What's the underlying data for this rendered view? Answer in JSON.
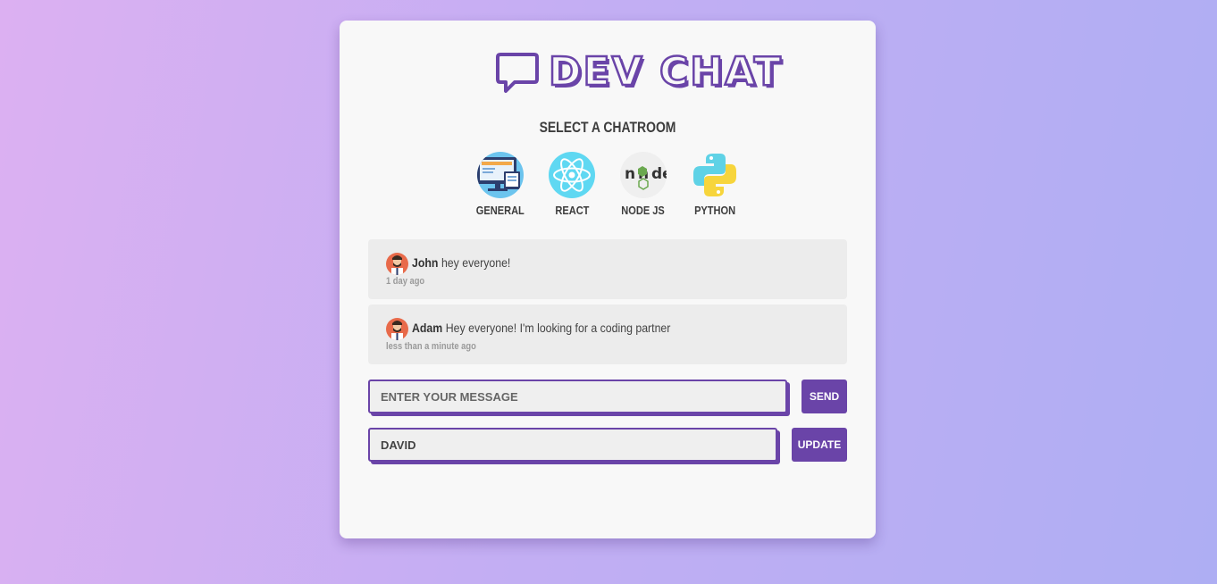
{
  "app": {
    "logo_text": "DEV CHAT"
  },
  "rooms_section": {
    "title": "SELECT A CHATROOM",
    "rooms": [
      {
        "label": "GENERAL",
        "icon": "computer-monitor-icon"
      },
      {
        "label": "REACT",
        "icon": "react-atom-icon"
      },
      {
        "label": "NODE JS",
        "icon": "nodejs-logo-icon"
      },
      {
        "label": "PYTHON",
        "icon": "python-logo-icon"
      }
    ]
  },
  "messages": [
    {
      "user": "John",
      "text": "hey everyone!",
      "time": "1 day ago"
    },
    {
      "user": "Adam",
      "text": "Hey everyone! I'm looking for a coding partner",
      "time": "less than a minute ago"
    }
  ],
  "composer": {
    "placeholder": "ENTER YOUR MESSAGE",
    "value": "",
    "send_label": "SEND"
  },
  "name_form": {
    "value": "DAVID",
    "update_label": "UPDATE"
  },
  "colors": {
    "accent": "#6a44a8",
    "card": "#f8f8f8",
    "message_bg": "#ececec",
    "avatar_bg": "#e86a4a"
  }
}
